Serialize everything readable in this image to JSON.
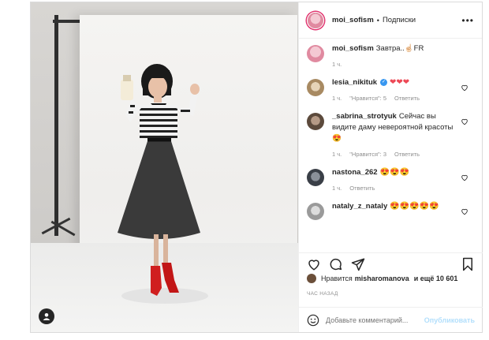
{
  "post": {
    "photo_alt": "",
    "author": {
      "username": "moi_sofism",
      "dot": "•",
      "follow_label": "Подписки"
    },
    "more_label": "•••"
  },
  "comments": [
    {
      "username": "moi_sofism",
      "text": "Завтра..☝🏻FR",
      "time": "1 ч.",
      "likes": "",
      "reply": "",
      "avatar_color": "#e8a3b3"
    },
    {
      "username": "lesia_nikituk",
      "verified": "✓",
      "text": "❤❤❤",
      "time": "1 ч.",
      "likes": "\"Нравится\": 5",
      "reply": "Ответить",
      "avatar_color": "#c9b08a"
    },
    {
      "username": "_sabrina_strotyuk",
      "text": "Сейчас вы видите даму невероятной красоты 😍",
      "time": "1 ч.",
      "likes": "\"Нравится\": 3",
      "reply": "Ответить",
      "avatar_color": "#7a6a5a"
    },
    {
      "username": "nastona_262",
      "text": "😍😍😍",
      "time": "1 ч.",
      "likes": "",
      "reply": "Ответить",
      "avatar_color": "#4a4f57"
    },
    {
      "username": "nataly_z_nataly",
      "text": "😍😍😍😍😍",
      "time": "",
      "likes": "",
      "reply": "",
      "avatar_color": "#b5b5b5"
    }
  ],
  "likes_line": {
    "prefix": "Нравится",
    "user": "misharomanova",
    "suffix": "и ещё 10 601"
  },
  "timestamp": "ЧАС НАЗАД",
  "add_comment": {
    "placeholder": "Добавьте комментарий...",
    "publish_label": "Опубликовать"
  },
  "icons": {
    "heart": "heart-icon",
    "comment": "comment-icon",
    "share": "share-icon",
    "save": "bookmark-icon",
    "emoji": "emoji-icon",
    "user": "user-tag-icon"
  },
  "colors": {
    "accent": "#3897f0",
    "like": "#ed4956",
    "publish": "#b2dffc",
    "muted": "#8e8e8e"
  }
}
